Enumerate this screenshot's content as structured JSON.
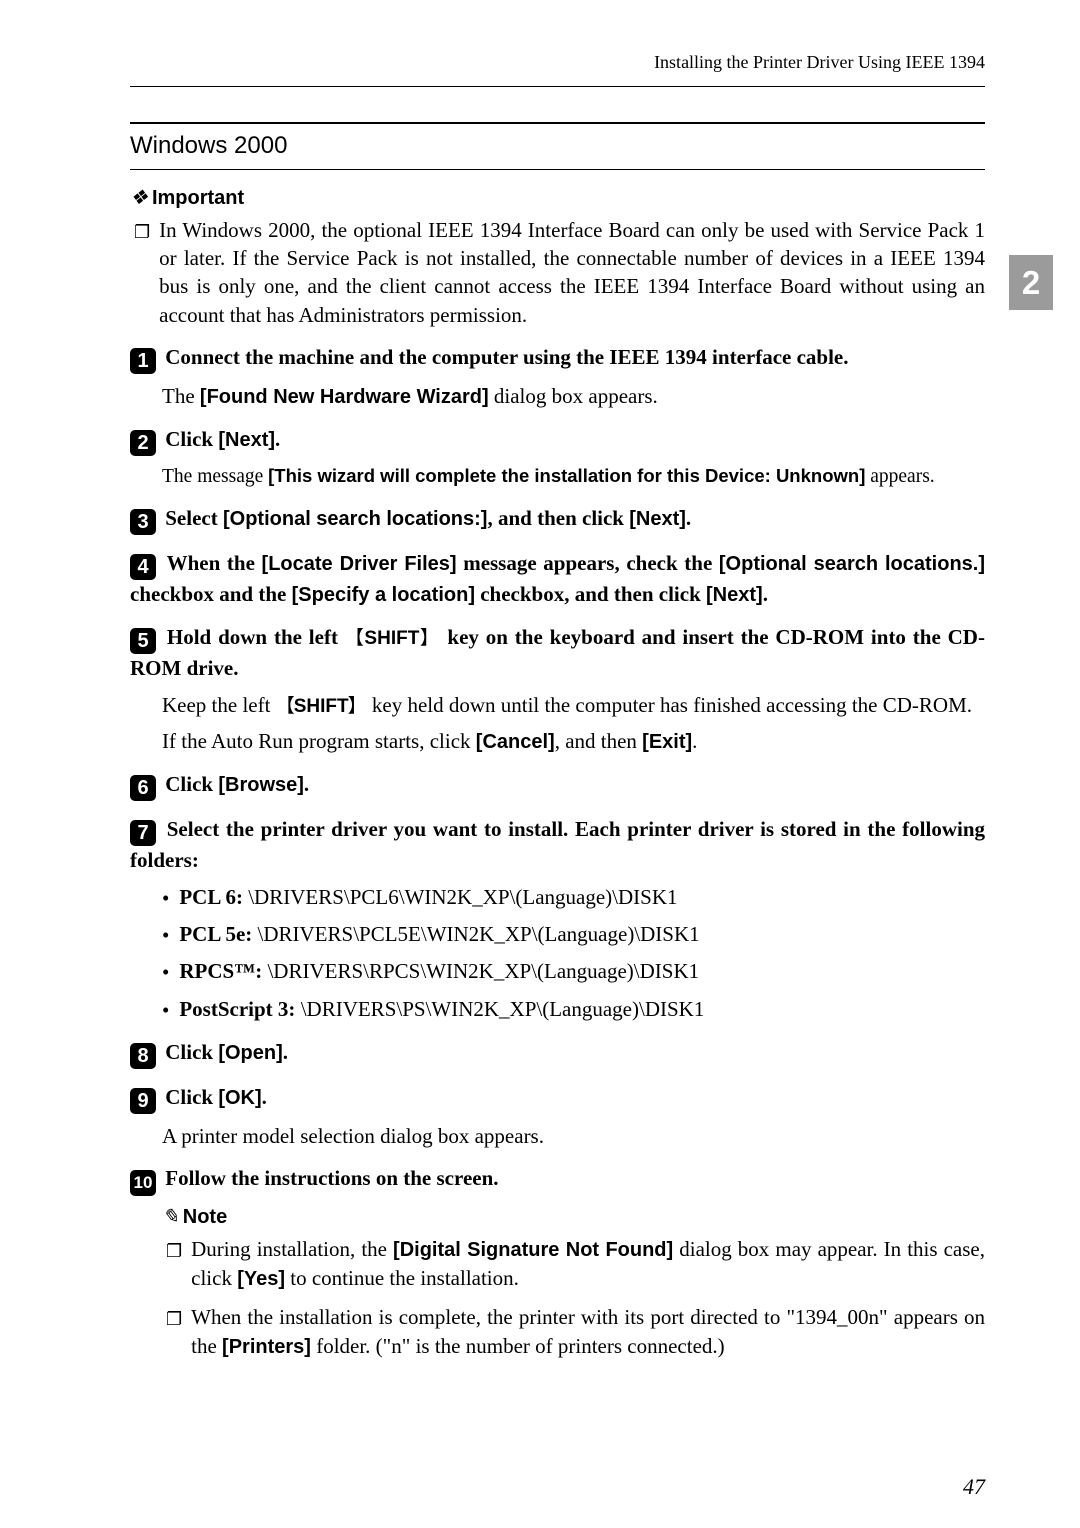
{
  "header_title": "Installing the Printer Driver Using IEEE 1394",
  "side_tab": "2",
  "section_title": "Windows 2000",
  "important_label": "Important",
  "important_text": "In Windows 2000, the optional IEEE 1394 Interface Board can only be used with Service Pack 1 or later. If the Service Pack is not installed, the connectable number of devices in a IEEE 1394 bus is only one, and the client cannot access the IEEE 1394 Interface Board without using an account that has Administrators permission.",
  "steps": {
    "s1": {
      "main_a": "Connect the machine and the computer using the IEEE 1394 interface cable.",
      "body_a": "The ",
      "body_ui": "[Found New Hardware Wizard]",
      "body_b": " dialog box appears."
    },
    "s2": {
      "main_a": "Click ",
      "main_ui": "[Next]",
      "main_b": ".",
      "body_a": "The message ",
      "body_ui": "[This wizard will complete the installation for this Device: Unknown]",
      "body_b": " appears."
    },
    "s3": {
      "main_a": "Select ",
      "main_ui1": "[Optional search locations:]",
      "main_b": ", and then click ",
      "main_ui2": "[Next]",
      "main_c": "."
    },
    "s4": {
      "main_a": "When the ",
      "main_ui1": "[Locate Driver Files]",
      "main_b": " message appears, check the ",
      "main_ui2": "[Optional search locations.]",
      "main_c": " checkbox and the ",
      "main_ui3": "[Specify a location]",
      "main_d": " checkbox, and then click ",
      "main_ui4": "[Next]",
      "main_e": "."
    },
    "s5": {
      "main_a": "Hold down the left ",
      "main_key": "SHIFT",
      "main_b": " key on the keyboard and insert the CD-ROM into the CD-ROM drive.",
      "body1_a": "Keep the left ",
      "body1_key": "SHIFT",
      "body1_b": " key held down until the computer has finished accessing the CD-ROM.",
      "body2_a": "If the Auto Run program starts, click ",
      "body2_ui1": "[Cancel]",
      "body2_b": ", and then ",
      "body2_ui2": "[Exit]",
      "body2_c": "."
    },
    "s6": {
      "main_a": "Click ",
      "main_ui": "[Browse]",
      "main_b": "."
    },
    "s7": {
      "main_a": "Select the printer driver you want to install. Each printer driver is stored in the following folders:",
      "items": [
        {
          "name": "PCL 6:",
          "path": " \\DRIVERS\\PCL6\\WIN2K_XP\\(Language)\\DISK1"
        },
        {
          "name": "PCL 5e:",
          "path": " \\DRIVERS\\PCL5E\\WIN2K_XP\\(Language)\\DISK1"
        },
        {
          "name": "RPCS™:",
          "path": " \\DRIVERS\\RPCS\\WIN2K_XP\\(Language)\\DISK1"
        },
        {
          "name": "PostScript 3:",
          "path": " \\DRIVERS\\PS\\WIN2K_XP\\(Language)\\DISK1"
        }
      ]
    },
    "s8": {
      "main_a": "Click ",
      "main_ui": "[Open]",
      "main_b": "."
    },
    "s9": {
      "main_a": "Click ",
      "main_ui": "[OK]",
      "main_b": ".",
      "body": "A printer model selection dialog box appears."
    },
    "s10": {
      "main_a": "Follow the instructions on the screen."
    }
  },
  "note_label": "Note",
  "notes": {
    "n1_a": "During installation, the ",
    "n1_ui1": "[Digital Signature Not Found]",
    "n1_b": " dialog box may appear. In this case, click ",
    "n1_ui2": "[Yes]",
    "n1_c": " to continue the installation.",
    "n2_a": "When the installation is complete, the printer with its port directed to \"1394_00n\" appears on the ",
    "n2_ui": "[Printers]",
    "n2_b": " folder. (\"n\" is the number of printers connected.)"
  },
  "page_number": "47"
}
